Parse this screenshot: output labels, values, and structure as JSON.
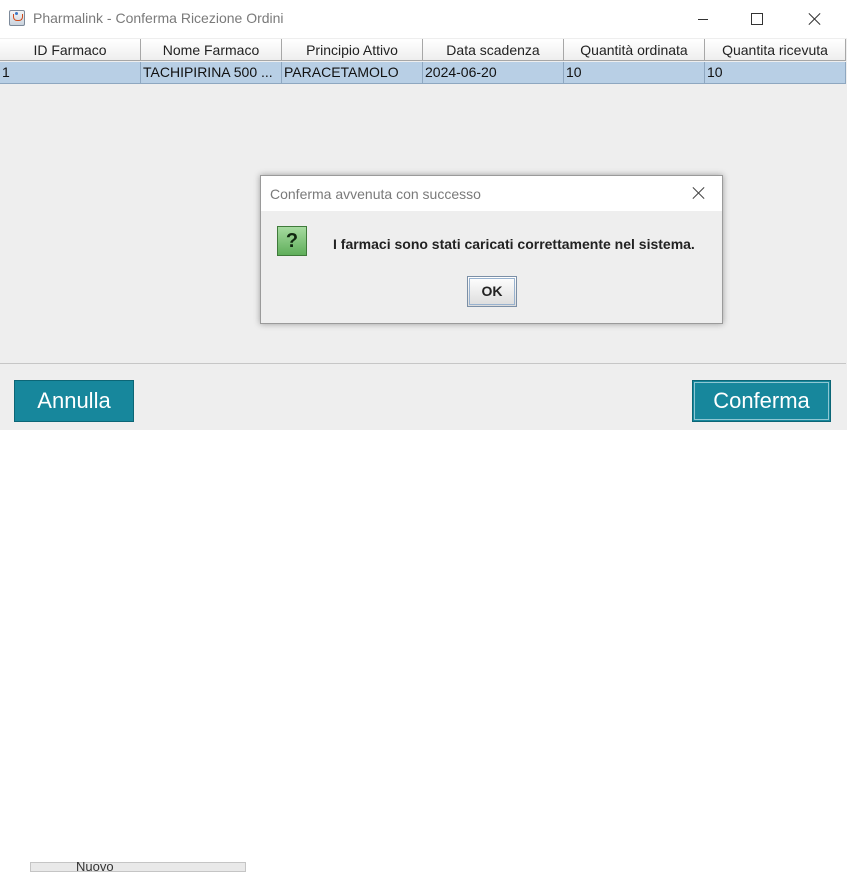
{
  "window": {
    "title": "Pharmalink - Conferma Ricezione Ordini",
    "icon": "java-cup-icon"
  },
  "table": {
    "columns": [
      "ID Farmaco",
      "Nome Farmaco",
      "Principio Attivo",
      "Data scadenza",
      "Quantità ordinata",
      "Quantita ricevuta"
    ],
    "rows": [
      [
        "1",
        "TACHIPIRINA 500 ...",
        "PARACETAMOLO",
        "2024-06-20",
        "10",
        "10"
      ]
    ]
  },
  "buttons": {
    "cancel": "Annulla",
    "confirm": "Conferma"
  },
  "background_hint": "Nuovo",
  "dialog": {
    "title": "Conferma avvenuta con successo",
    "icon_glyph": "?",
    "message": "I farmaci sono stati caricati correttamente nel sistema.",
    "ok": "OK"
  },
  "colors": {
    "accent": "#17879c",
    "selection": "#b8cfe5"
  }
}
